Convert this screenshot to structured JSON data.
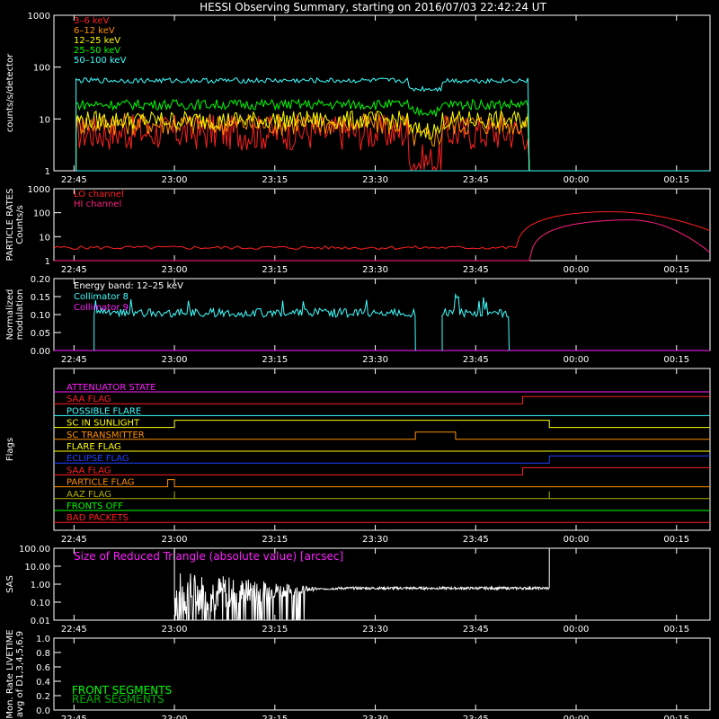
{
  "title": "HESSI Observing Summary, starting on 2016/07/03 22:42:24 UT",
  "time_ticks": [
    "22:45",
    "23:00",
    "23:15",
    "23:30",
    "23:45",
    "00:00",
    "00:15"
  ],
  "colors": {
    "c3_6": "#ff2020",
    "c6_12": "#ff9000",
    "c12_25": "#ffff00",
    "c25_50": "#00ff00",
    "c50_100": "#40ffff",
    "lo": "#ff2020",
    "hi": "#ff2080",
    "collimator8": "#40ffff",
    "collimator9": "#ff20ff",
    "sas": "#ffffff",
    "sas_label": "#ff20ff",
    "front": "#00ff00",
    "rear": "#00b000"
  },
  "chart_data": [
    {
      "id": "counts",
      "type": "line",
      "ylabel": "counts/s/detector",
      "yscale": "log",
      "ylim": [
        1,
        1000
      ],
      "yticks": [
        "1",
        "10",
        "100",
        "1000"
      ],
      "x_unit": "UT time (hours since 22:42:24 UT)",
      "segments": [
        [
          0.05,
          5.12
        ],
        [
          5.9,
          7.4
        ]
      ],
      "series": [
        {
          "name": "3–6 keV",
          "level": 5.5,
          "noise": 0.35,
          "bump": -0.05
        },
        {
          "name": "6–12 keV",
          "level": 8.0,
          "noise": 0.22,
          "bump": 0.0
        },
        {
          "name": "12–25 keV",
          "level": 9.5,
          "noise": 0.18,
          "bump": 0.0
        },
        {
          "name": "25–50 keV",
          "level": 19.0,
          "noise": 0.1,
          "bump": 0.0
        },
        {
          "name": "50–100 keV",
          "level": 55.0,
          "noise": 0.05,
          "bump": 0.0
        }
      ],
      "gaps": [
        [
          5.12,
          5.9
        ]
      ],
      "gap_levels": [
        1.5,
        4.5,
        6.0,
        14.0,
        38.0
      ],
      "data_end_time": "23:50"
    },
    {
      "id": "particle",
      "type": "line",
      "ylabel_1": "PARTICLE RATES",
      "ylabel_2": "Counts/s",
      "yscale": "log",
      "ylim": [
        1,
        1000
      ],
      "yticks": [
        "1",
        "10",
        "100",
        "1000"
      ],
      "series": [
        {
          "name": "LO channel",
          "base": 3.5,
          "peak": 110,
          "rise_start": "23:51",
          "peak_time": "00:05",
          "fall_end": "00:21"
        },
        {
          "name": "HI channel",
          "base": 1.0,
          "peak": 50,
          "rise_start": "23:53",
          "peak_time": "00:08",
          "fall_end": "00:21"
        }
      ]
    },
    {
      "id": "modulation",
      "type": "line",
      "ylabel_1": "Normalized",
      "ylabel_2": "modulation",
      "ylim": [
        0.0,
        0.2
      ],
      "yticks": [
        "0.00",
        "0.05",
        "0.10",
        "0.15",
        "0.20"
      ],
      "legend_title": "Energy band: 12–25 keV",
      "series": [
        {
          "name": "Collimator 8",
          "level": 0.105,
          "spread": 0.012,
          "segments": [
            [
              "22:48",
              "23:36"
            ],
            [
              "23:40",
              "23:50"
            ]
          ]
        },
        {
          "name": "Collimator 9",
          "level": 0.0,
          "segments": [
            [
              "22:42",
              "00:21"
            ]
          ]
        }
      ]
    },
    {
      "id": "flags",
      "type": "step",
      "ylabel": "Flags",
      "flags": [
        {
          "name": "ATTENUATOR STATE",
          "color": "#ff20ff",
          "steps": []
        },
        {
          "name": "SAA FLAG",
          "color": "#ff2020",
          "steps": [
            [
              "23:52",
              1
            ]
          ]
        },
        {
          "name": "POSSIBLE FLARE",
          "color": "#40ffff",
          "steps": []
        },
        {
          "name": "SC IN SUNLIGHT",
          "color": "#ffff00",
          "steps": [
            [
              "23:00",
              1
            ],
            [
              "23:56",
              0
            ]
          ]
        },
        {
          "name": "SC TRANSMITTER",
          "color": "#ff9000",
          "steps": [
            [
              "23:36",
              1
            ],
            [
              "23:42",
              0
            ]
          ]
        },
        {
          "name": "FLARE FLAG",
          "color": "#ffff00",
          "steps": []
        },
        {
          "name": "ECLIPSE FLAG",
          "color": "#2040ff",
          "steps": [
            [
              "23:00",
              0
            ],
            [
              "23:56",
              1
            ]
          ]
        },
        {
          "name": "SAA FLAG",
          "color": "#ff2020",
          "steps": [
            [
              "23:52",
              1
            ]
          ]
        },
        {
          "name": "PARTICLE FLAG",
          "color": "#ff9000",
          "steps": [
            [
              "22:59",
              1
            ],
            [
              "23:00",
              0
            ]
          ]
        },
        {
          "name": "AAZ FLAG",
          "color": "#b0b000",
          "steps": [
            [
              "23:00",
              1
            ],
            [
              "23:00",
              0
            ],
            [
              "23:56",
              1
            ],
            [
              "23:56",
              0
            ]
          ]
        },
        {
          "name": "FRONTS OFF",
          "color": "#00ff00",
          "steps": []
        },
        {
          "name": "BAD PACKETS",
          "color": "#ff2020",
          "steps": []
        }
      ]
    },
    {
      "id": "sas",
      "type": "line",
      "ylabel": "SAS",
      "yscale": "log",
      "ylim": [
        0.01,
        100
      ],
      "yticks": [
        "0.01",
        "0.10",
        "1.00",
        "10.00",
        "100.00"
      ],
      "annotation": "Size of Reduced Triangle (absolute value) [arcsec]",
      "series": [
        {
          "name": "SAS",
          "start": "23:00",
          "end": "23:56",
          "level_start": 0.25,
          "level_end": 0.6
        }
      ]
    },
    {
      "id": "livetime",
      "type": "line",
      "ylabel_1": "Mon. Rate LIVETIME",
      "ylabel_2": "avg of D1,3,4,5,6,9",
      "ylim": [
        0.0,
        1.0
      ],
      "yticks": [
        "0.0",
        "0.2",
        "0.4",
        "0.6",
        "0.8",
        "1.0"
      ],
      "series": [
        {
          "name": "FRONT SEGMENTS"
        },
        {
          "name": "REAR SEGMENTS"
        }
      ]
    }
  ]
}
